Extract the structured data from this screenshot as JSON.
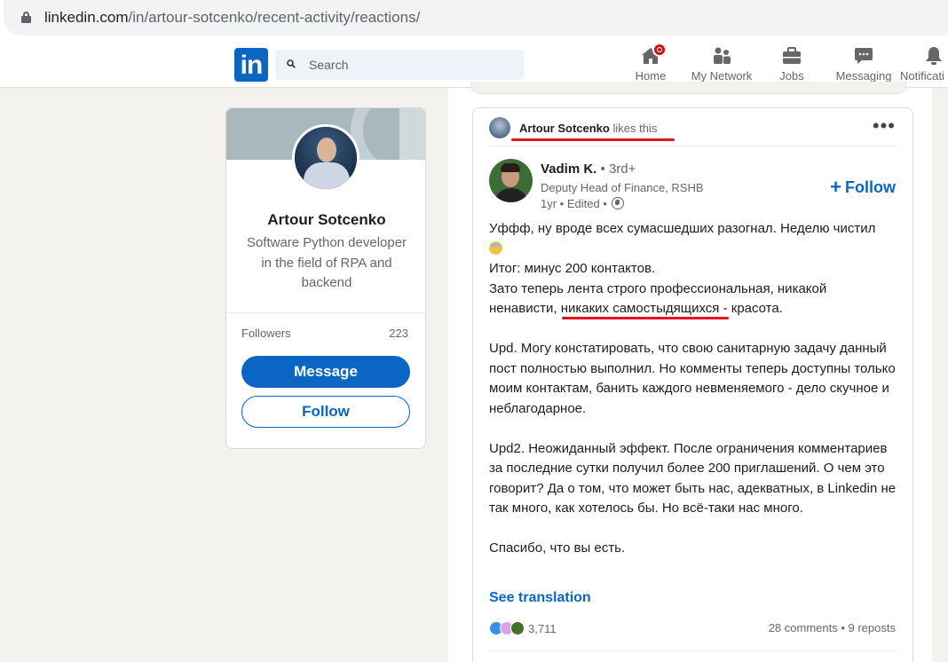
{
  "browser": {
    "url_host": "linkedin.com",
    "url_path": "/in/artour-sotcenko/recent-activity/reactions/"
  },
  "nav": {
    "logo": "in",
    "search_placeholder": "Search",
    "items": [
      {
        "label": "Home",
        "icon": "home-icon",
        "badge": true
      },
      {
        "label": "My Network",
        "icon": "people-icon"
      },
      {
        "label": "Jobs",
        "icon": "briefcase-icon"
      },
      {
        "label": "Messaging",
        "icon": "chat-icon"
      },
      {
        "label": "Notificati",
        "icon": "bell-icon"
      }
    ]
  },
  "profile": {
    "name": "Artour Sotcenko",
    "headline": "Software Python developer in the field of RPA and backend",
    "followers_label": "Followers",
    "followers_count": "223",
    "message_label": "Message",
    "follow_label": "Follow"
  },
  "post": {
    "context_name": "Artour Sotcenko",
    "context_action": "likes this",
    "more": "•••",
    "author_name": "Vadim K.",
    "author_degree": "• 3rd+",
    "author_headline": "Deputy Head of Finance, RSHB",
    "author_meta": "1yr • Edited •",
    "follow_label": "Follow",
    "body": {
      "line1": "Уффф, ну вроде всех сумасшедших разогнал. Неделю чистил",
      "line2": "Итог: минус 200 контактов.",
      "line3": "Зато теперь лента строго профессиональная, никакой",
      "line4a": "ненависти,",
      "line4b": "никаких самостыдящихся",
      "line4c": "- красота.",
      "upd1": "Upd. Могу констатировать, что свою санитарную задачу данный пост полностью выполнил. Но комменты теперь доступны только моим контактам, банить каждого невменяемого - дело скучное и неблагодарное.",
      "upd2": "Upd2. Неожиданный эффект. После ограничения комментариев за последние сутки получил более 200 приглашений. О чем это говорит? Да о том, что может быть нас, адекватных, в Linkedin не так много, как хотелось бы. Но всё-таки нас много.",
      "thanks": "Спасибо, что вы есть."
    },
    "see_translation": "See translation",
    "reactions_count": "3,711",
    "comments": "28 comments",
    "reposts": "9 reposts",
    "stats_sep": " • "
  },
  "colors": {
    "accent": "#0a66c2",
    "annotation": "#e3141e"
  }
}
